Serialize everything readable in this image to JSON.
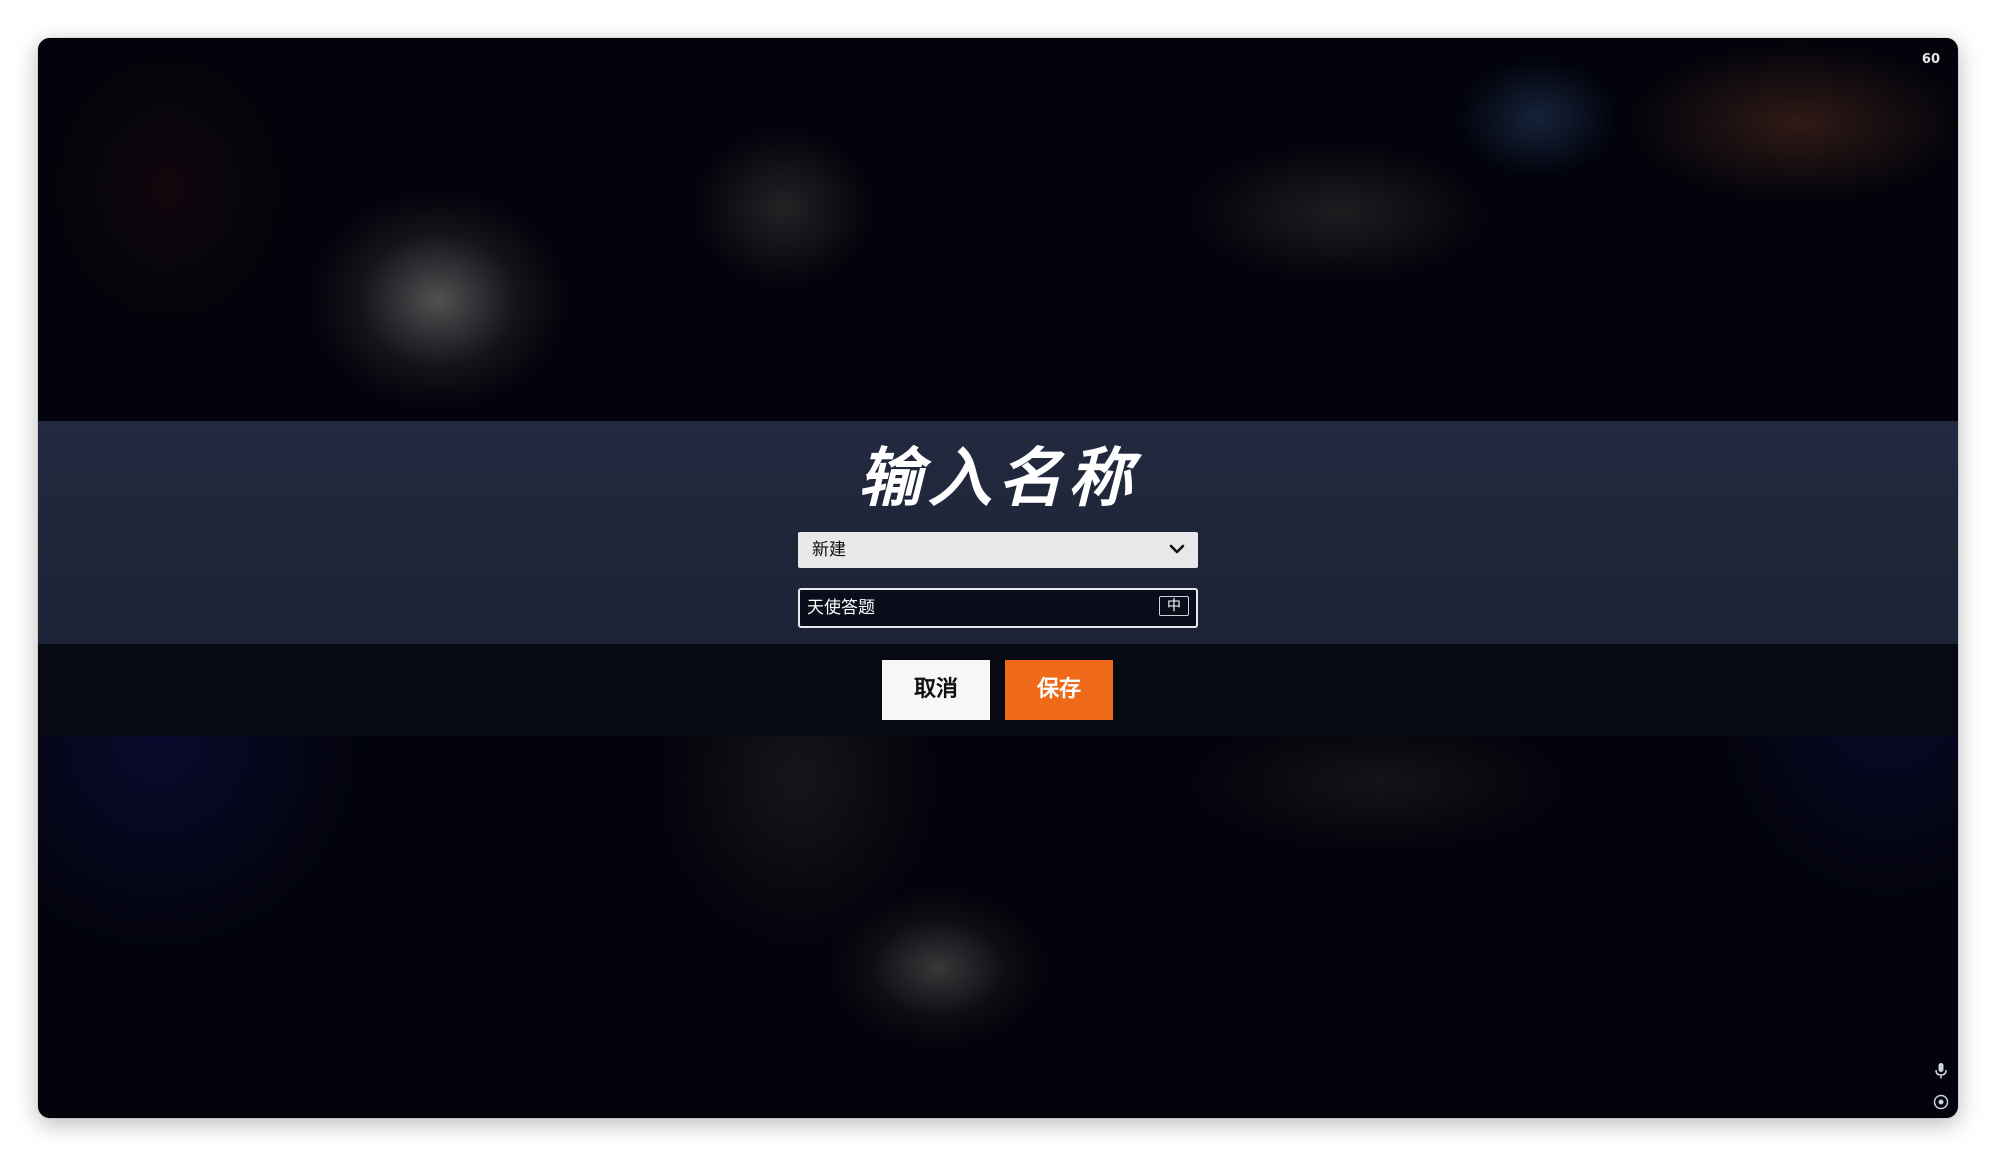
{
  "hud": {
    "fps": "60"
  },
  "dialog": {
    "title": "输入名称",
    "dropdown": {
      "selected": "新建",
      "icon": "chevron-down-icon"
    },
    "name_input": {
      "value": "天使答题",
      "ime_indicator": "中"
    },
    "buttons": {
      "cancel_label": "取消",
      "save_label": "保存"
    }
  },
  "corner_icons": [
    "microphone-icon",
    "settings-dot-icon"
  ],
  "colors": {
    "accent": "#ee6a18",
    "dialog_band": "#1f2639",
    "button_band": "#070a12",
    "cancel_button": "#f7f7f7"
  }
}
